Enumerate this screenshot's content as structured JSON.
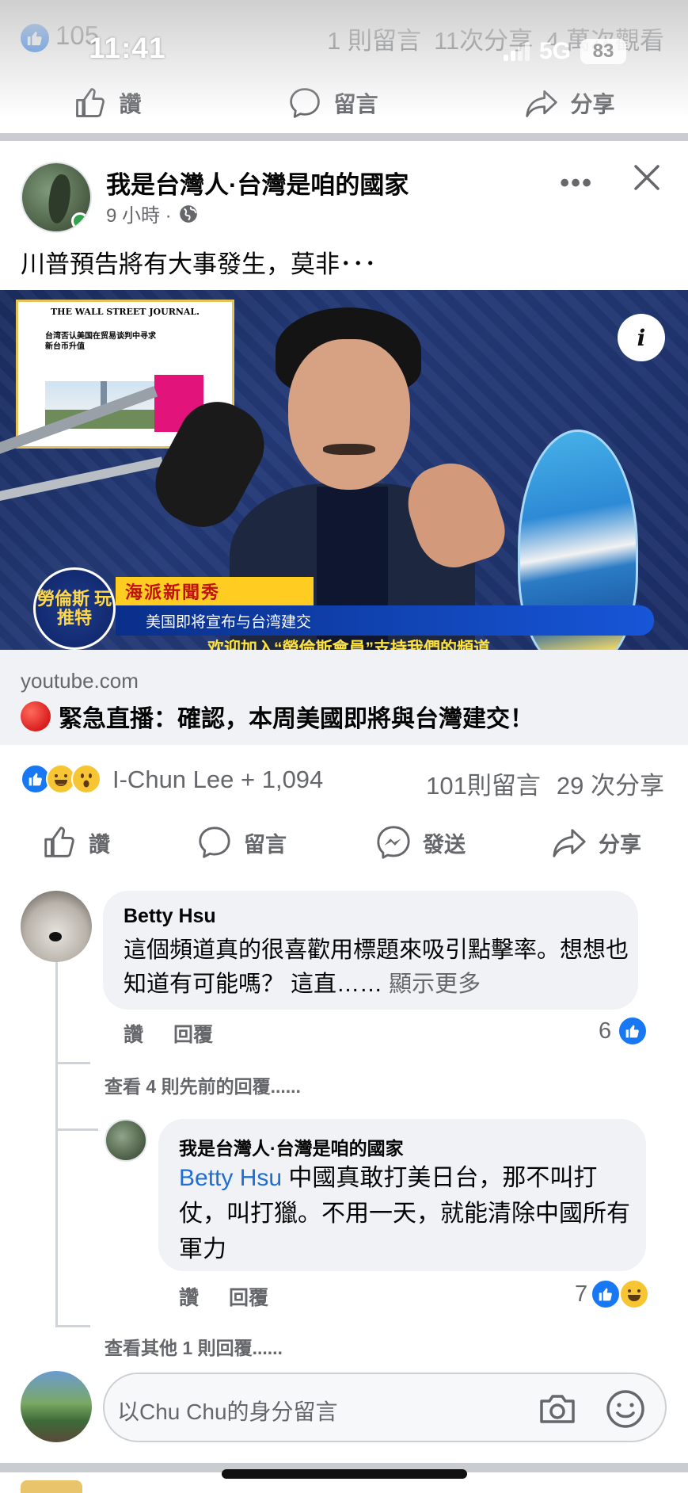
{
  "status_bar": {
    "time": "11:41",
    "network": "5G",
    "battery": "83"
  },
  "previous_post": {
    "like_count": "105",
    "comments": "1 則留言",
    "shares": "11次分享",
    "views": "4 萬次觀看",
    "actions": {
      "like": "讚",
      "comment": "留言",
      "share": "分享"
    }
  },
  "post": {
    "page_name": "我是台灣人·台灣是咱的國家",
    "time_ago": "9 小時 ·",
    "privacy_icon": "globe-icon",
    "text": "川普預告將有大事發生，莫非･･･",
    "video": {
      "newspaper_title": "THE WALL STREET JOURNAL.",
      "newspaper_headline": "台湾否认美国在贸易谈判中寻求新台币升值",
      "logo_text": "勞倫斯 玩推特",
      "show_title": "海派新聞秀",
      "subtitle": "美国即将宣布与台湾建交",
      "ticker": "欢迎加入“勞倫斯會員”支持我們的頻道"
    },
    "link": {
      "domain": "youtube.com",
      "title": "緊急直播：確認，本周美國即將與台灣建交！"
    },
    "reactions": {
      "icons": [
        "like",
        "haha",
        "wow"
      ],
      "summary": "I-Chun Lee + 1,094",
      "comments": "101則留言",
      "shares": "29 次分享"
    },
    "actions": {
      "like": "讚",
      "comment": "留言",
      "send": "發送",
      "share": "分享"
    }
  },
  "comments": [
    {
      "author": "Betty Hsu",
      "text": "這個頻道真的很喜歡用標題來吸引點擊率。想想也知道有可能嗎？ 這直……",
      "see_more": "顯示更多",
      "like": "讚",
      "reply": "回覆",
      "reaction_count": "6",
      "previous_replies": "查看 4 則先前的回覆......",
      "replies": [
        {
          "author": "我是台灣人·台灣是咱的國家",
          "tag": "Betty Hsu",
          "text": " 中國真敢打美日台，那不叫打仗，叫打獵。不用一天，就能清除中國所有軍力",
          "like": "讚",
          "reply": "回覆",
          "reaction_count": "7"
        }
      ],
      "more_replies": "查看其他 1 則回覆......"
    }
  ],
  "composer": {
    "placeholder": "以Chu Chu的身分留言"
  },
  "colors": {
    "facebook_blue": "#1877f2",
    "secondary_text": "#65676b",
    "bubble_bg": "#f0f2f5"
  }
}
